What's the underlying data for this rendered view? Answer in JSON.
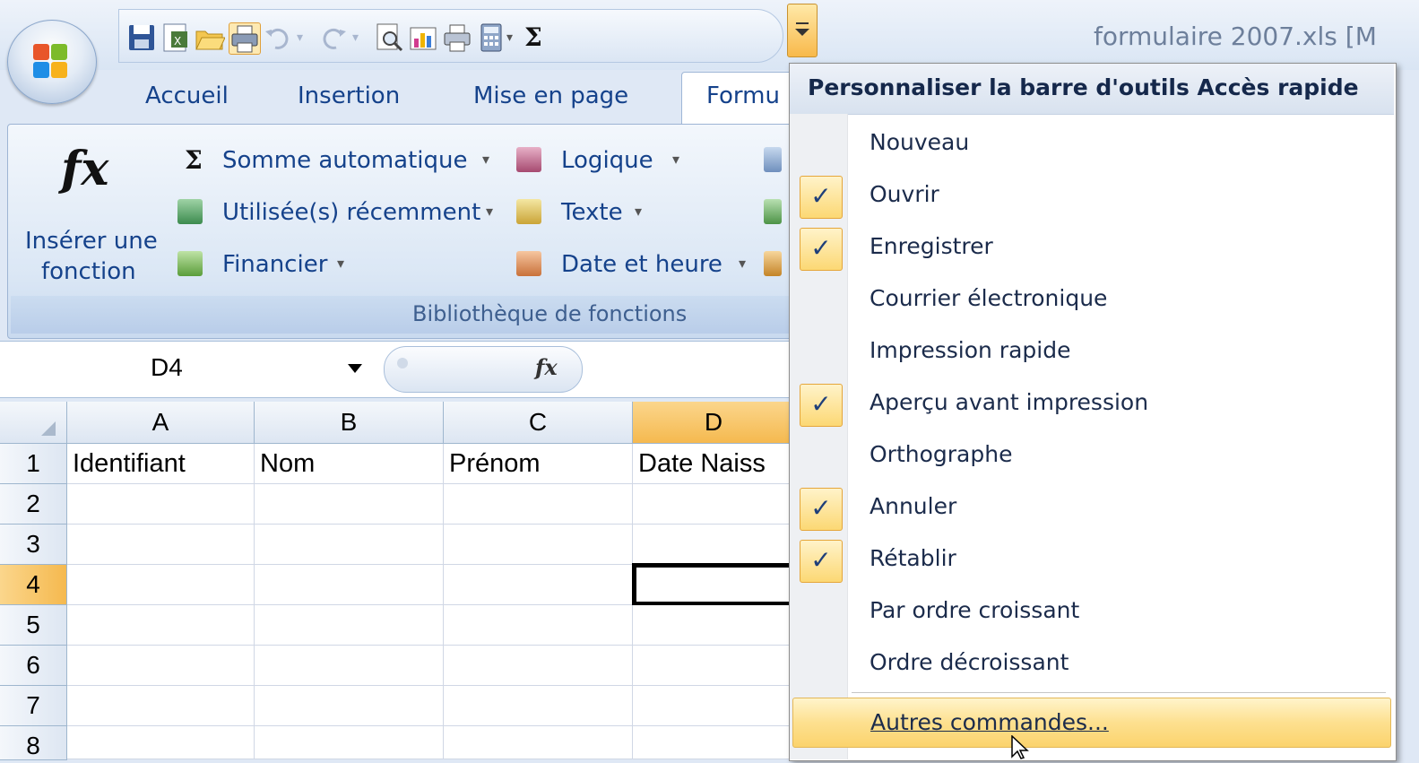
{
  "window": {
    "title": "formulaire 2007.xls  [M"
  },
  "qat": {
    "icons": [
      "save-icon",
      "pdf-icon",
      "open-icon",
      "print-icon",
      "undo-icon",
      "redo-icon",
      "print-preview-icon",
      "chart-icon",
      "print-quick-icon",
      "calculator-icon",
      "sum-icon"
    ],
    "sum_label": "Σ"
  },
  "tabs": [
    "Accueil",
    "Insertion",
    "Mise en page",
    "Formu"
  ],
  "ribbon": {
    "insert_function": {
      "line1": "Insérer une",
      "line2": "fonction",
      "icon": "fx"
    },
    "col1": [
      "Somme automatique",
      "Utilisée(s) récemment",
      "Financier"
    ],
    "col2": [
      "Logique",
      "Texte",
      "Date et heure"
    ],
    "sum_symbol": "Σ",
    "group_label": "Bibliothèque de fonctions",
    "dropdown_arrow": "▾"
  },
  "formula_bar": {
    "name_box": "D4",
    "fx_label": "fx",
    "content": ""
  },
  "grid": {
    "columns": [
      "A",
      "B",
      "C",
      "D"
    ],
    "rows": [
      "1",
      "2",
      "3",
      "4",
      "5",
      "6",
      "7",
      "8"
    ],
    "row1": [
      "Identifiant",
      "Nom",
      "Prénom",
      "Date Naiss"
    ],
    "selected_cell": "D4"
  },
  "menu": {
    "header": "Personnaliser la barre d'outils Accès rapide",
    "items": [
      {
        "label": "Nouveau",
        "checked": false
      },
      {
        "label": "Ouvrir",
        "checked": true
      },
      {
        "label": "Enregistrer",
        "checked": true
      },
      {
        "label": "Courrier électronique",
        "checked": false
      },
      {
        "label": "Impression rapide",
        "checked": false
      },
      {
        "label": "Aperçu avant impression",
        "checked": true
      },
      {
        "label": "Orthographe",
        "checked": false
      },
      {
        "label": "Annuler",
        "checked": true
      },
      {
        "label": "Rétablir",
        "checked": true
      },
      {
        "label": "Par ordre croissant",
        "checked": false
      },
      {
        "label": "Ordre décroissant",
        "checked": false
      }
    ],
    "more": "Autres commandes...",
    "check_glyph": "✓"
  },
  "colors": {
    "accent": "#15428b",
    "ribbon_bg": "#dbe7f5",
    "highlight": "#fde08f"
  }
}
